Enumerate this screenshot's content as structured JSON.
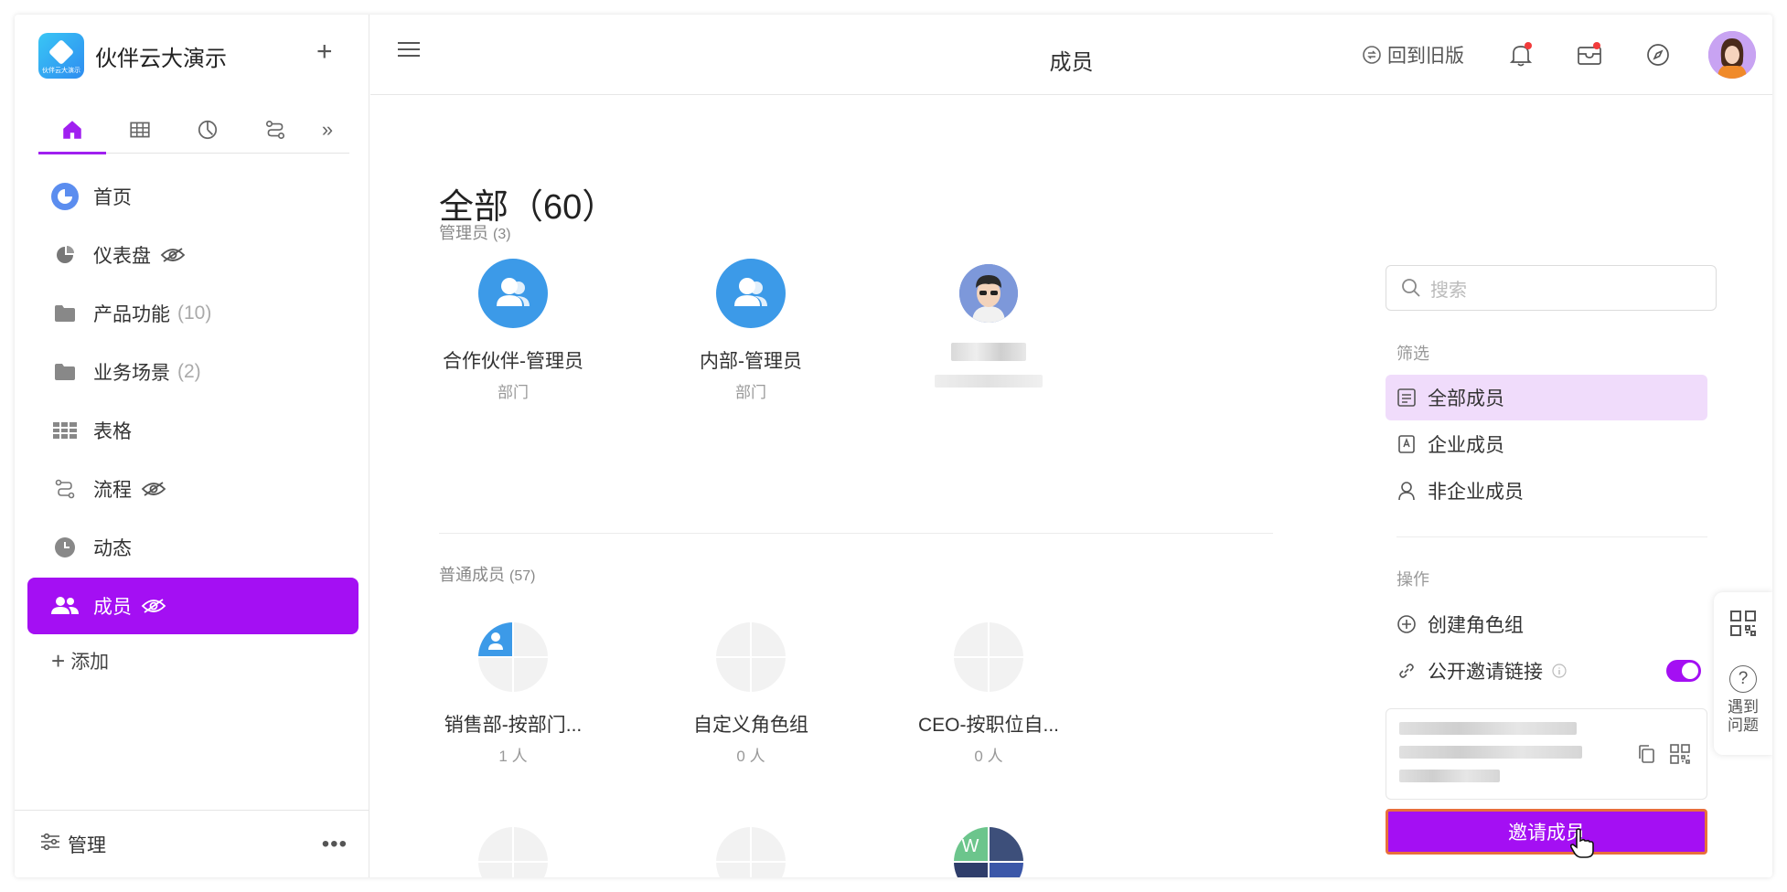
{
  "app": {
    "brand_name": "伙伴云大演示",
    "brand_caption": "伙伴云大演示"
  },
  "sidebar": {
    "tabs": [
      {
        "icon": "home-icon",
        "active": true
      },
      {
        "icon": "table-icon",
        "active": false
      },
      {
        "icon": "dashboard-icon",
        "active": false
      },
      {
        "icon": "workflow-icon",
        "active": false
      }
    ],
    "more_tabs": "»",
    "items": [
      {
        "label": "首页",
        "icon": "home-circle-icon",
        "count": "",
        "hidden": false,
        "active": false
      },
      {
        "label": "仪表盘",
        "icon": "pie-chart-icon",
        "count": "",
        "hidden": true,
        "active": false
      },
      {
        "label": "产品功能",
        "icon": "folder-icon",
        "count": "(10)",
        "hidden": false,
        "active": false
      },
      {
        "label": "业务场景",
        "icon": "folder-icon",
        "count": "(2)",
        "hidden": false,
        "active": false
      },
      {
        "label": "表格",
        "icon": "grid-icon",
        "count": "",
        "hidden": false,
        "active": false
      },
      {
        "label": "流程",
        "icon": "flow-icon",
        "count": "",
        "hidden": true,
        "active": false
      },
      {
        "label": "动态",
        "icon": "clock-icon",
        "count": "",
        "hidden": false,
        "active": false
      },
      {
        "label": "成员",
        "icon": "users-icon",
        "count": "",
        "hidden": true,
        "active": true
      }
    ],
    "add_label": "添加",
    "manage_label": "管理",
    "more_label": "•••"
  },
  "header": {
    "title": "成员",
    "old_version": "回到旧版"
  },
  "main": {
    "page_title": "全部（60）",
    "admins": {
      "label": "管理员",
      "count": "(3)",
      "members": [
        {
          "name": "合作伙伴-管理员",
          "sub": "部门"
        },
        {
          "name": "内部-管理员",
          "sub": "部门"
        }
      ]
    },
    "regular": {
      "label": "普通成员",
      "count": "(57)",
      "members": [
        {
          "name": "销售部-按部门...",
          "sub": "1 人"
        },
        {
          "name": "自定义角色组",
          "sub": "0 人"
        },
        {
          "name": "CEO-按职位自...",
          "sub": "0 人"
        }
      ]
    }
  },
  "right_panel": {
    "search_placeholder": "搜索",
    "filter_label": "筛选",
    "filters": [
      {
        "label": "全部成员",
        "active": true
      },
      {
        "label": "企业成员",
        "active": false
      },
      {
        "label": "非企业成员",
        "active": false
      }
    ],
    "actions_label": "操作",
    "create_role_group": "创建角色组",
    "public_invite_link": "公开邀请链接",
    "public_invite_enabled": true,
    "invite_button": "邀请成员"
  },
  "float_help": {
    "help_label_1": "遇到",
    "help_label_2": "问题"
  },
  "colors": {
    "accent": "#a40ff3",
    "accent_light": "#f0dcfb",
    "blue_avatar": "#3c9ae8",
    "notify_dot": "#f23b3b",
    "invite_border": "#e86f3c"
  }
}
